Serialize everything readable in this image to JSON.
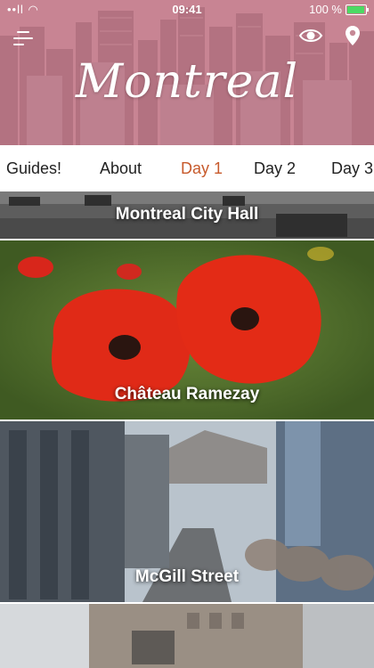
{
  "status_bar": {
    "signal": "••ll",
    "wifi": "WiFi",
    "time": "09:41",
    "battery_percent": "100 %"
  },
  "header": {
    "title": "Montreal",
    "menu_icon": "menu-icon",
    "eye_icon": "eye-icon",
    "location_icon": "location-pin-icon"
  },
  "tabs": [
    {
      "label": "Guides!",
      "active": false
    },
    {
      "label": "About",
      "active": false
    },
    {
      "label": "Day 1",
      "active": true
    },
    {
      "label": "Day 2",
      "active": false
    },
    {
      "label": "Day 3",
      "active": false
    }
  ],
  "places": [
    {
      "name": "Montreal City Hall"
    },
    {
      "name": "Château Ramezay"
    },
    {
      "name": "McGill Street"
    },
    {
      "name": ""
    }
  ],
  "colors": {
    "accent": "#c75a2c",
    "header_tint": "#b87884",
    "battery": "#4cd964"
  }
}
